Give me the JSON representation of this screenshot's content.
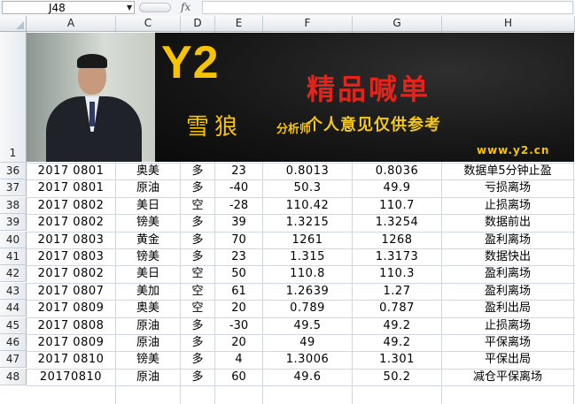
{
  "formula_bar": {
    "name_box": "J48",
    "fx_label": "fx",
    "formula": ""
  },
  "columns": [
    "A",
    "C",
    "D",
    "E",
    "F",
    "G",
    "H"
  ],
  "banner": {
    "logo": "Y2",
    "signature": "雪狼",
    "analyst_label": "分析师",
    "title": "精品喊单",
    "subtitle": "个人意见仅供参考",
    "url": "www.y2.cn"
  },
  "banner_row": "1",
  "rows": [
    {
      "row": "36",
      "date": "2017 0801",
      "pair": "奥美",
      "dir": "多",
      "pts": "23",
      "open": "0.8013",
      "close": "0.8036",
      "note": "数据单5分钟止盈"
    },
    {
      "row": "37",
      "date": "2017 0801",
      "pair": "原油",
      "dir": "多",
      "pts": "-40",
      "open": "50.3",
      "close": "49.9",
      "note": "亏损离场"
    },
    {
      "row": "38",
      "date": "2017 0802",
      "pair": "美日",
      "dir": "空",
      "pts": "-28",
      "open": "110.42",
      "close": "110.7",
      "note": "止损离场"
    },
    {
      "row": "39",
      "date": "2017 0802",
      "pair": "镑美",
      "dir": "多",
      "pts": "39",
      "open": "1.3215",
      "close": "1.3254",
      "note": "数据前出"
    },
    {
      "row": "40",
      "date": "2017 0803",
      "pair": "黄金",
      "dir": "多",
      "pts": "70",
      "open": "1261",
      "close": "1268",
      "note": "盈利离场"
    },
    {
      "row": "41",
      "date": "2017 0803",
      "pair": "镑美",
      "dir": "多",
      "pts": "23",
      "open": "1.315",
      "close": "1.3173",
      "note": "数据快出"
    },
    {
      "row": "42",
      "date": "2017 0802",
      "pair": "美日",
      "dir": "空",
      "pts": "50",
      "open": "110.8",
      "close": "110.3",
      "note": "盈利离场"
    },
    {
      "row": "43",
      "date": "2017 0807",
      "pair": "美加",
      "dir": "空",
      "pts": "61",
      "open": "1.2639",
      "close": "1.27",
      "note": "盈利离场"
    },
    {
      "row": "44",
      "date": "2017 0809",
      "pair": "奥美",
      "dir": "空",
      "pts": "20",
      "open": "0.789",
      "close": "0.787",
      "note": "盈利出局"
    },
    {
      "row": "45",
      "date": "2017 0808",
      "pair": "原油",
      "dir": "多",
      "pts": "-30",
      "open": "49.5",
      "close": "49.2",
      "note": "止损离场"
    },
    {
      "row": "46",
      "date": "2017 0809",
      "pair": "原油",
      "dir": "多",
      "pts": "20",
      "open": "49",
      "close": "49.2",
      "note": "平保离场"
    },
    {
      "row": "47",
      "date": "2017 0810",
      "pair": "镑美",
      "dir": "多",
      "pts": "4",
      "open": "1.3006",
      "close": "1.301",
      "note": "平保出局"
    },
    {
      "row": "48",
      "date": "20170810",
      "pair": "原油",
      "dir": "多",
      "pts": "60",
      "open": "49.6",
      "close": "50.2",
      "note": "减仓平保离场"
    }
  ]
}
